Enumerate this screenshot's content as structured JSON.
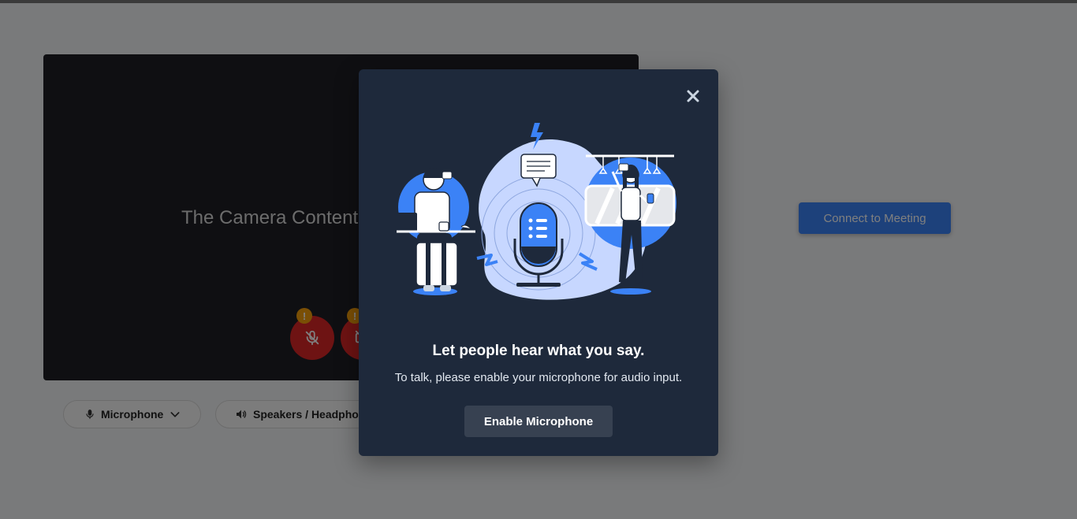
{
  "background": {
    "camera_preview_text": "The Camera Content W",
    "microphone_label": "Microphone",
    "speakers_label": "Speakers / Headphones",
    "connect_label": "Connect to Meeting",
    "warning_glyph": "!"
  },
  "modal": {
    "title": "Let people hear what you say.",
    "description": "To talk, please enable your microphone for audio input.",
    "enable_label": "Enable Microphone",
    "close_icon": "close-icon"
  },
  "colors": {
    "accent": "#3b82f6",
    "modal_bg": "#1e293b",
    "danger": "#dc2626",
    "warning": "#f59e0b"
  }
}
